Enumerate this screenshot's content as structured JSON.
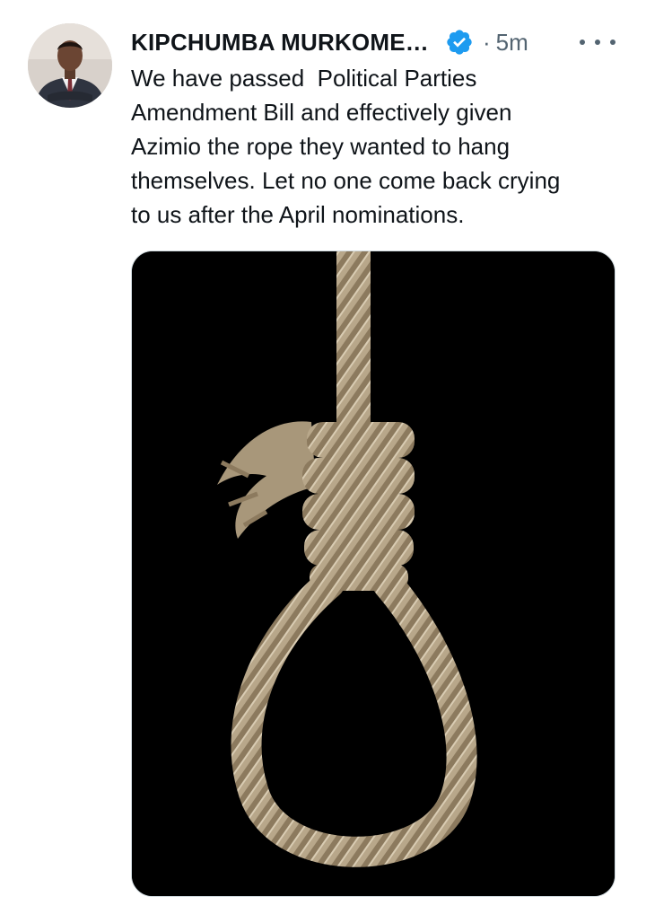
{
  "tweet": {
    "author": {
      "display_name": "KIPCHUMBA MURKOME…",
      "verified": true,
      "avatar_icon": "user-avatar-photo"
    },
    "separator": "·",
    "timestamp": "5m",
    "more_icon": "more-horizontal-icon",
    "text": "We have passed  Political Parties\nAmendment Bill and effectively given\nAzimio the rope they wanted to hang\nthemselves. Let no one come back crying\nto us after the April nominations.",
    "media": {
      "icon": "noose-rope-image",
      "background_color": "#000000"
    },
    "colors": {
      "verified_badge": "#1d9bf0",
      "secondary_text": "#536471",
      "primary_text": "#0f1419"
    }
  }
}
